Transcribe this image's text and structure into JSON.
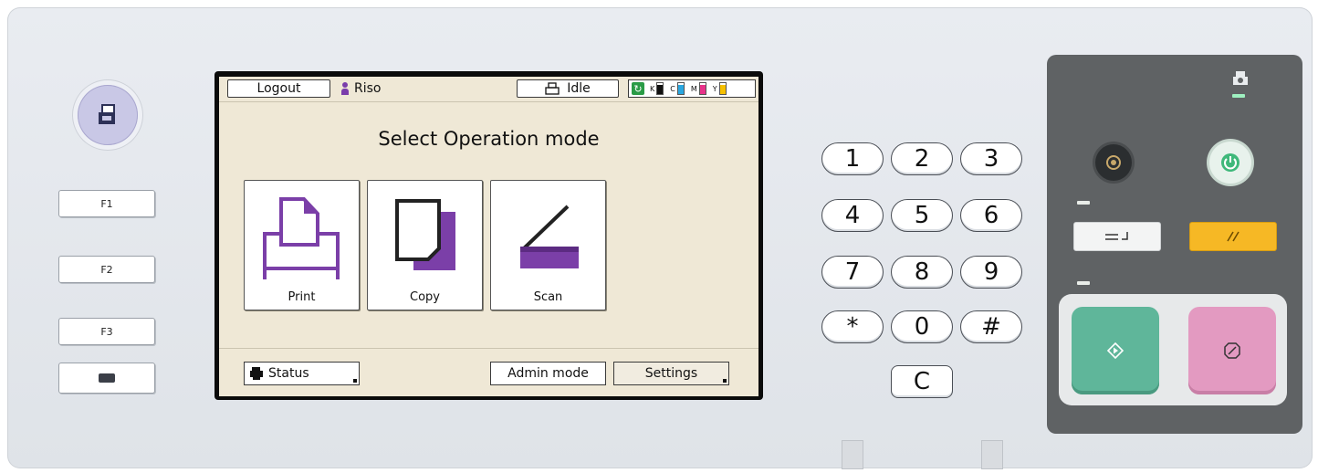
{
  "left": {
    "home_icon": "mode-switch-icon",
    "f_keys": [
      "F1",
      "F2",
      "F3"
    ],
    "counter_icon": "counter-icon"
  },
  "screen": {
    "top_bar": {
      "logout_label": "Logout",
      "user_name": "Riso",
      "printer_status": "Idle",
      "ink": [
        {
          "label": "K",
          "color": "#111111",
          "level": 0.8
        },
        {
          "label": "C",
          "color": "#2aa7e0",
          "level": 0.8
        },
        {
          "label": "M",
          "color": "#e8338a",
          "level": 0.8
        },
        {
          "label": "Y",
          "color": "#f6c000",
          "level": 0.8
        }
      ]
    },
    "title": "Select Operation mode",
    "modes": [
      {
        "label": "Print",
        "icon": "print-icon"
      },
      {
        "label": "Copy",
        "icon": "copy-icon"
      },
      {
        "label": "Scan",
        "icon": "scan-icon"
      }
    ],
    "bottom_bar": {
      "status_label": "Status",
      "admin_label": "Admin mode",
      "settings_label": "Settings"
    },
    "accent_color": "#7b3fa8"
  },
  "keypad": {
    "keys": [
      "1",
      "2",
      "3",
      "4",
      "5",
      "6",
      "7",
      "8",
      "9",
      "*",
      "0",
      "#"
    ],
    "clear": "C"
  },
  "controls": {
    "wake_icon": "wake-up-icon",
    "power_icon": "power-icon",
    "interrupt_icon": "interrupt-icon",
    "reset_icon": "reset-icon",
    "start_icon": "start-icon",
    "stop_icon": "stop-icon",
    "start_color": "#5fb69a",
    "stop_color": "#e39ac1",
    "reset_color": "#f6b825"
  }
}
